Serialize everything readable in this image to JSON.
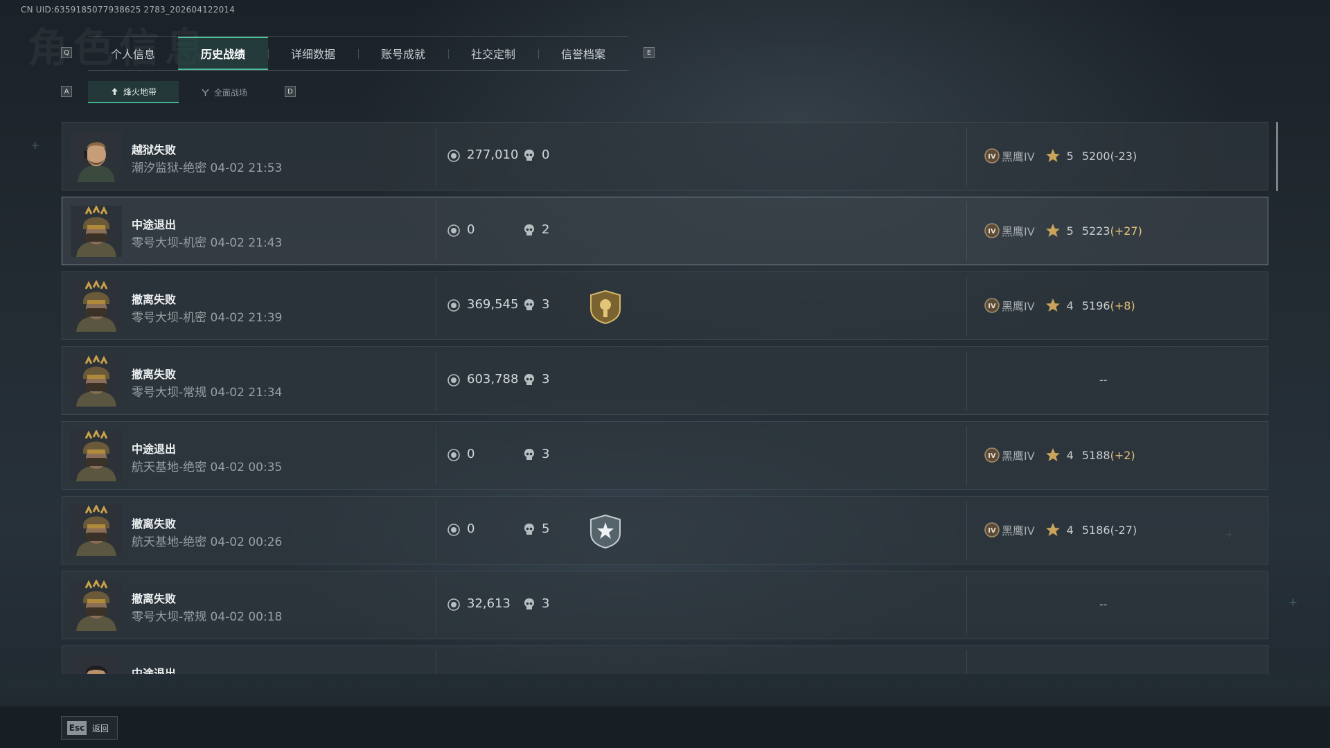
{
  "uid": "CN UID:6359185077938625 2783_202604122014",
  "background_title": "角色信息",
  "tabs": {
    "key_left": "Q",
    "key_right": "E",
    "items": [
      {
        "label": "个人信息",
        "active": false
      },
      {
        "label": "历史战绩",
        "active": true
      },
      {
        "label": "详细数据",
        "active": false
      },
      {
        "label": "账号成就",
        "active": false
      },
      {
        "label": "社交定制",
        "active": false
      },
      {
        "label": "信誉档案",
        "active": false
      }
    ]
  },
  "subtabs": {
    "key_left": "A",
    "key_right": "D",
    "items": [
      {
        "label": "烽火地带",
        "icon": "extraction-icon",
        "active": true
      },
      {
        "label": "全面战场",
        "icon": "battlefield-icon",
        "active": false
      }
    ]
  },
  "rows": [
    {
      "title": "越狱失败",
      "subtitle": "潮汐监狱-绝密 04-02 21:53",
      "money": "277,010",
      "kills": "0",
      "avatar": "operator-male-bearded",
      "badge": null,
      "rank": "黑鹰IV",
      "stars": "5",
      "score": "5200",
      "delta": "(-23)",
      "delta_positive": false,
      "has_rank": true
    },
    {
      "title": "中途退出",
      "subtitle": "零号大坝-机密 04-02 21:43",
      "money": "0",
      "kills": "2",
      "avatar": "operator-helmet-gold",
      "badge": null,
      "rank": "黑鹰IV",
      "stars": "5",
      "score": "5223",
      "delta": "(+27)",
      "delta_positive": true,
      "has_rank": true
    },
    {
      "title": "撤离失败",
      "subtitle": "零号大坝-机密 04-02 21:39",
      "money": "369,545",
      "kills": "3",
      "avatar": "operator-helmet-gold",
      "badge": "gold-shield-badge",
      "rank": "黑鹰IV",
      "stars": "4",
      "score": "5196",
      "delta": "(+8)",
      "delta_positive": true,
      "has_rank": true
    },
    {
      "title": "撤离失败",
      "subtitle": "零号大坝-常规 04-02 21:34",
      "money": "603,788",
      "kills": "3",
      "avatar": "operator-helmet-gold",
      "badge": null,
      "rank": "",
      "stars": "",
      "score": "",
      "delta": "",
      "delta_positive": false,
      "has_rank": false,
      "empty_rank": "--"
    },
    {
      "title": "中途退出",
      "subtitle": "航天基地-绝密 04-02 00:35",
      "money": "0",
      "kills": "3",
      "avatar": "operator-helmet-gold",
      "badge": null,
      "rank": "黑鹰IV",
      "stars": "4",
      "score": "5188",
      "delta": "(+2)",
      "delta_positive": true,
      "has_rank": true
    },
    {
      "title": "撤离失败",
      "subtitle": "航天基地-绝密 04-02 00:26",
      "money": "0",
      "kills": "5",
      "avatar": "operator-helmet-gold",
      "badge": "silver-star-shield-badge",
      "rank": "黑鹰IV",
      "stars": "4",
      "score": "5186",
      "delta": "(-27)",
      "delta_positive": false,
      "has_rank": true
    },
    {
      "title": "撤离失败",
      "subtitle": "零号大坝-常规 04-02 00:18",
      "money": "32,613",
      "kills": "3",
      "avatar": "operator-helmet-gold",
      "badge": null,
      "rank": "",
      "stars": "",
      "score": "",
      "delta": "",
      "delta_positive": false,
      "has_rank": false,
      "empty_rank": "--"
    },
    {
      "title": "中途退出",
      "subtitle": "",
      "money": "",
      "kills": "",
      "avatar": "operator-male-short-hair",
      "badge": null,
      "rank": "",
      "stars": "",
      "score": "",
      "delta": "",
      "delta_positive": false,
      "has_rank": false,
      "empty_rank": ""
    }
  ],
  "footer": {
    "key": "Esc",
    "label": "返回"
  },
  "icons": {
    "currency": "hafu-coin-icon",
    "kills": "skull-icon",
    "rank": "rank-iv-emblem-icon",
    "star": "star-icon"
  },
  "colors": {
    "accent": "#4fc09a",
    "delta_positive": "#e6c27a",
    "panel": "#30383f"
  }
}
